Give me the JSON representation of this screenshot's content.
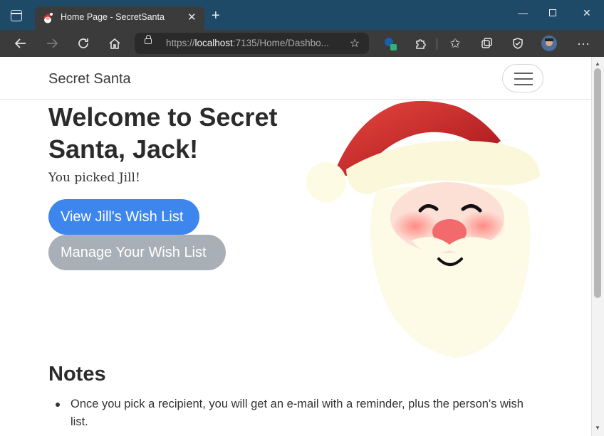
{
  "browser": {
    "tab_title": "Home Page - SecretSanta",
    "url_scheme": "https://",
    "url_host": "localhost",
    "url_rest": ":7135/Home/Dashbo...",
    "icons": [
      "window-menu-icon",
      "santa-favicon",
      "close-icon",
      "new-tab-icon",
      "back-icon",
      "forward-icon",
      "refresh-icon",
      "home-icon",
      "lock-icon",
      "favorite-add-icon",
      "extension-badge-icon",
      "extensions-icon",
      "favorites-icon",
      "collections-icon",
      "browser-essentials-icon",
      "profile-avatar",
      "more-icon",
      "minimize-icon",
      "maximize-icon",
      "window-close-icon"
    ]
  },
  "navbar": {
    "brand": "Secret Santa"
  },
  "main": {
    "welcome": "Welcome to Secret Santa, Jack!",
    "picked": "You picked Jill!",
    "view_button": "View Jill's Wish List",
    "manage_button": "Manage Your Wish List"
  },
  "notes": {
    "heading": "Notes",
    "items": [
      "Once you pick a recipient, you will get an e-mail with a reminder, plus the person's wish list."
    ]
  },
  "colors": {
    "primary": "#3d86ee",
    "secondary": "#a9afb6",
    "tabbar": "#1e4a68",
    "toolbar": "#3b3b3b"
  }
}
